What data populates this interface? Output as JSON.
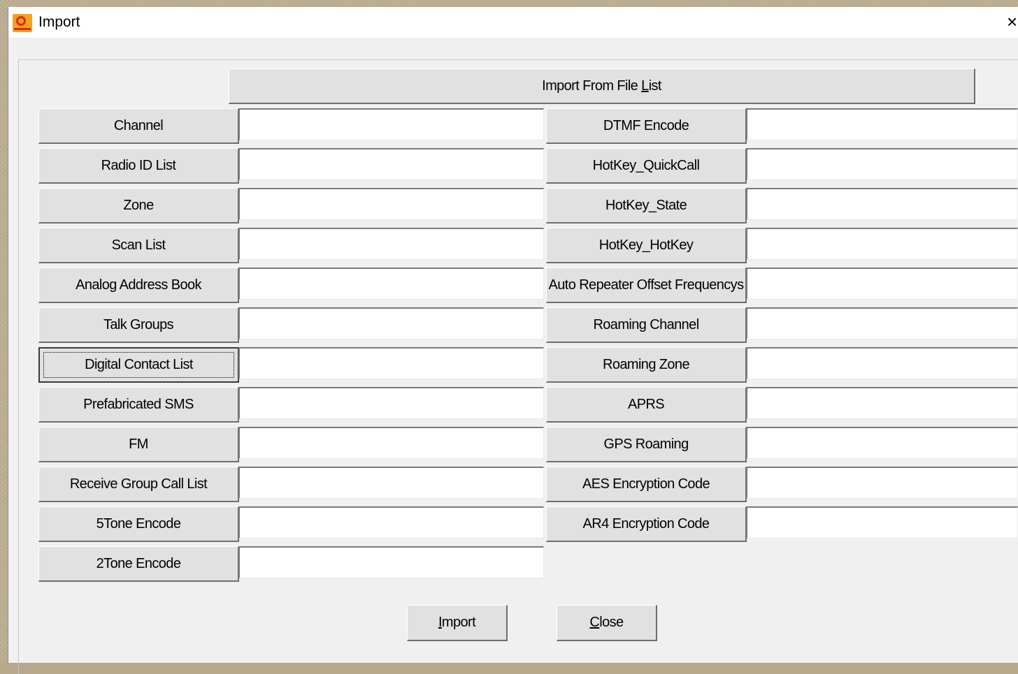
{
  "window": {
    "title": "Import",
    "close_glyph": "×"
  },
  "import_from_file_list": {
    "pre": "Import From File ",
    "accel": "L",
    "post": "ist"
  },
  "left_rows": [
    {
      "label": "Channel",
      "value": ""
    },
    {
      "label": "Radio ID List",
      "value": ""
    },
    {
      "label": "Zone",
      "value": ""
    },
    {
      "label": "Scan List",
      "value": ""
    },
    {
      "label": "Analog Address Book",
      "value": ""
    },
    {
      "label": "Talk Groups",
      "value": ""
    },
    {
      "label": "Digital Contact List",
      "value": ""
    },
    {
      "label": "Prefabricated SMS",
      "value": ""
    },
    {
      "label": "FM",
      "value": ""
    },
    {
      "label": "Receive Group Call List",
      "value": ""
    },
    {
      "label": "5Tone Encode",
      "value": ""
    },
    {
      "label": "2Tone Encode",
      "value": ""
    }
  ],
  "right_rows": [
    {
      "label": "DTMF Encode",
      "value": ""
    },
    {
      "label": "HotKey_QuickCall",
      "value": ""
    },
    {
      "label": "HotKey_State",
      "value": ""
    },
    {
      "label": "HotKey_HotKey",
      "value": ""
    },
    {
      "label": "Auto Repeater Offset Frequencys",
      "value": ""
    },
    {
      "label": "Roaming Channel",
      "value": ""
    },
    {
      "label": "Roaming Zone",
      "value": ""
    },
    {
      "label": "APRS",
      "value": ""
    },
    {
      "label": "GPS Roaming",
      "value": ""
    },
    {
      "label": "AES Encryption Code",
      "value": ""
    },
    {
      "label": "AR4 Encryption Code",
      "value": ""
    }
  ],
  "footer": {
    "import": {
      "accel": "I",
      "rest": "mport"
    },
    "close": {
      "accel": "C",
      "rest": "lose"
    }
  },
  "focused_left_row": 6,
  "colors": {
    "icon_orange": "#f3a21b",
    "icon_red": "#d82a1a"
  }
}
